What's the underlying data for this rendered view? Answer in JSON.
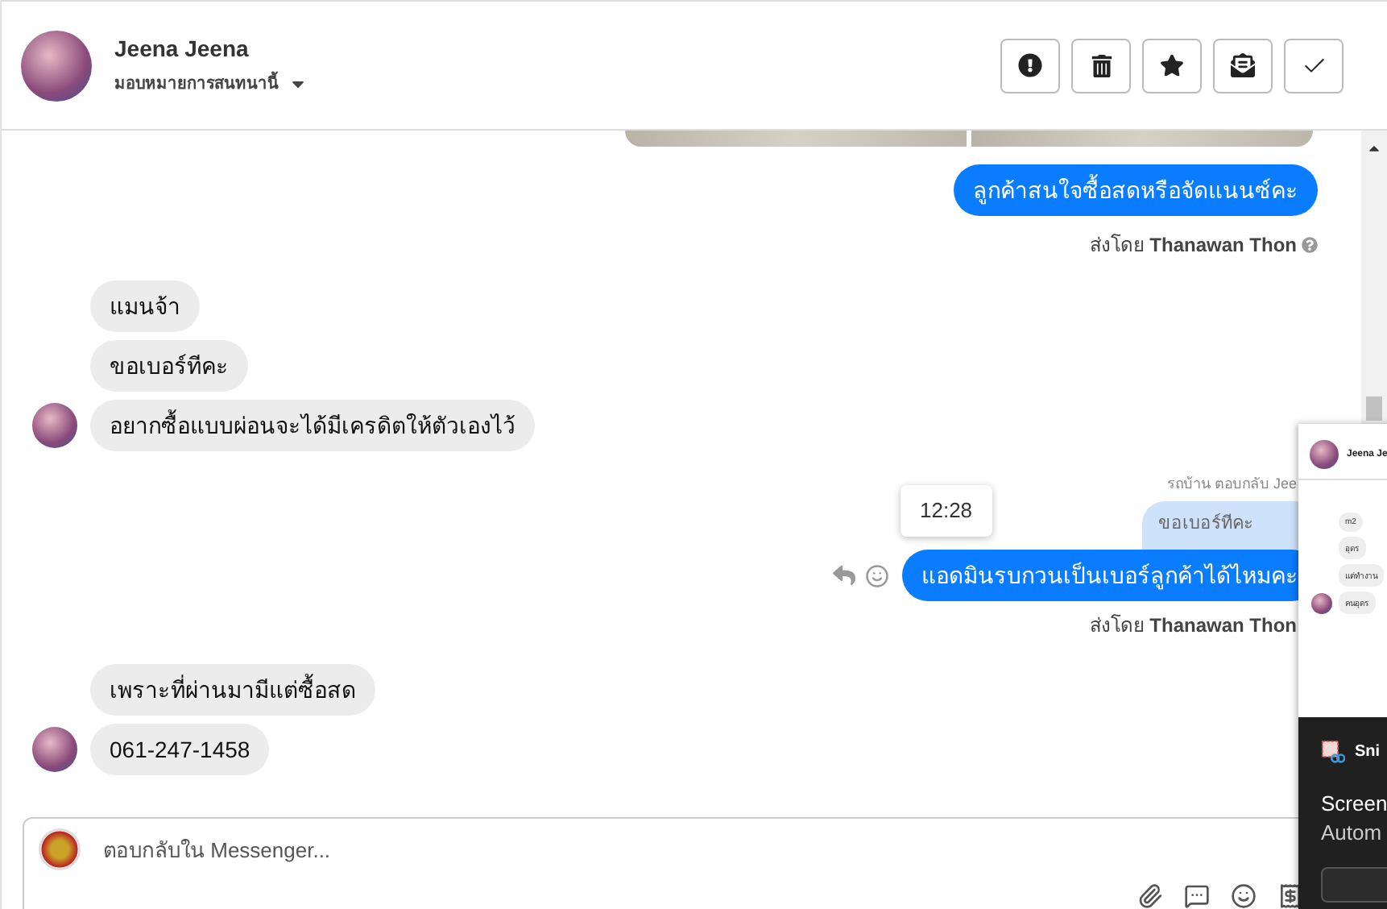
{
  "header": {
    "name": "Jeena Jeena",
    "assign_label": "มอบหมายการสนทนานี้",
    "actions": [
      {
        "kind": "alert"
      },
      {
        "kind": "trash"
      },
      {
        "kind": "star"
      },
      {
        "kind": "envelope"
      },
      {
        "kind": "check"
      }
    ]
  },
  "messages": [
    {
      "kind": "photos"
    },
    {
      "kind": "outgoing",
      "text": "ลูกค้าสนใจซื้อสดหรือจัดแนนซ์คะ"
    },
    {
      "kind": "sender",
      "prefix": "ส่งโดย",
      "name": "Thanawan Thon",
      "help": true
    },
    {
      "kind": "incoming",
      "text": "แมนจ้า",
      "avatar": false
    },
    {
      "kind": "incoming",
      "text": "ขอเบอร์ทีคะ",
      "avatar": false
    },
    {
      "kind": "incoming",
      "text": "อยากซื้อแบบผ่อนจะได้มีเครดิตให้ตัวเองไว้",
      "avatar": true
    },
    {
      "kind": "reply_note",
      "text": "รถบ้าน ตอบกลับ Jee"
    },
    {
      "kind": "quote",
      "text": "ขอเบอร์ทีคะ"
    },
    {
      "kind": "outgoing",
      "text": "แอดมินรบกวนเป็นเบอร์ลูกค้าได้ไหมคะ",
      "time": "12:28"
    },
    {
      "kind": "sender",
      "prefix": "ส่งโดย",
      "name": "Thanawan Thon",
      "help": false
    },
    {
      "kind": "incoming",
      "text": "เพราะที่ผ่านมามีแต่ซื้อสด",
      "avatar": false
    },
    {
      "kind": "incoming",
      "text": "061-247-1458",
      "avatar": true
    }
  ],
  "composer": {
    "placeholder": "ตอบกลับใน Messenger..."
  },
  "overlay": {
    "preview_name": "Jeena Je",
    "preview_messages": [
      "m2",
      "อุดร",
      "แต่ทำงาน",
      "คนอุดร"
    ],
    "app_name": "Sni",
    "lines": [
      "Screen",
      "Autom"
    ]
  }
}
